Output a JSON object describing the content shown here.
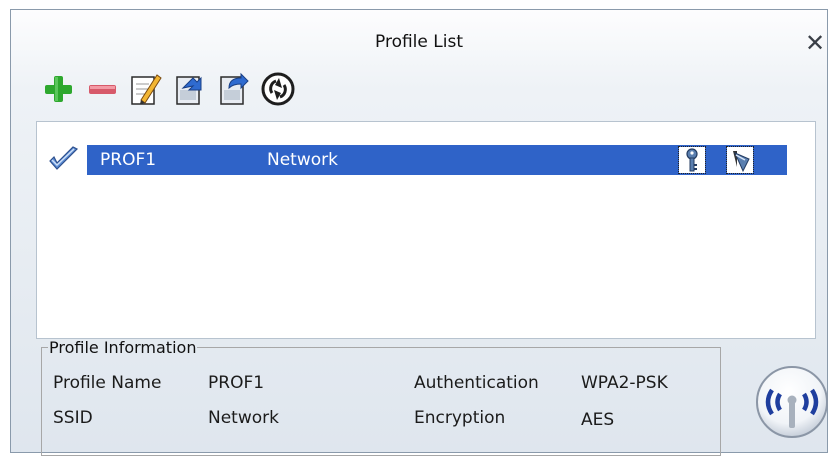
{
  "window": {
    "title": "Profile List",
    "close_icon": "close-icon"
  },
  "toolbar": {
    "icons": [
      "add-icon",
      "remove-icon",
      "edit-icon",
      "import-icon",
      "export-icon",
      "connect-icon"
    ]
  },
  "profiles": [
    {
      "name": "PROF1",
      "ssid": "Network",
      "active": true,
      "icons": [
        "check-icon",
        "key-icon",
        "shield-icon"
      ]
    }
  ],
  "profile_info": {
    "legend": "Profile Information",
    "profile_name_label": "Profile Name",
    "profile_name_value": "PROF1",
    "ssid_label": "SSID",
    "ssid_value": "Network",
    "authentication_label": "Authentication",
    "authentication_value": "WPA2-PSK",
    "encryption_label": "Encryption",
    "encryption_value": "AES"
  },
  "colors": {
    "selection": "#2f63c8",
    "add_green": "#2ea82e",
    "remove_red": "#d75a6a"
  }
}
